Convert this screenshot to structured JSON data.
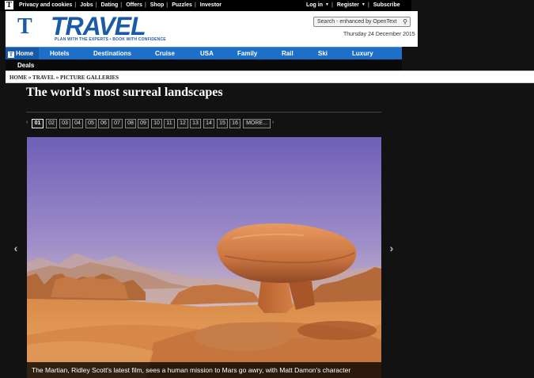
{
  "topbar": {
    "links": [
      "Privacy and cookies",
      "Jobs",
      "Dating",
      "Offers",
      "Shop",
      "Puzzles",
      "Investor"
    ],
    "login": "Log in",
    "register": "Register",
    "subscribe": "Subscribe"
  },
  "masthead": {
    "logo_letter": "T",
    "logo_word": "TRAVEL",
    "tagline": "PLAN WITH THE EXPERTS • BOOK WITH CONFIDENCE",
    "search_placeholder": "Search - enhanced by OpenText",
    "date": "Thursday 24 December 2015"
  },
  "nav": {
    "home": "Home",
    "items": [
      "Hotels",
      "Destinations",
      "Cruise",
      "USA",
      "Family",
      "Rail",
      "Ski",
      "Luxury"
    ],
    "sub_items": [
      "Deals"
    ]
  },
  "breadcrumb": [
    "HOME",
    "TRAVEL",
    "PICTURE GALLERIES"
  ],
  "breadcrumb_sep": "»",
  "page_title": "The world's most surreal landscapes",
  "pager": {
    "prev": "‹",
    "next": "›",
    "pages": [
      "01",
      "02",
      "03",
      "04",
      "05",
      "06",
      "07",
      "08",
      "09",
      "10",
      "11",
      "12",
      "13",
      "14",
      "15",
      "16"
    ],
    "current": "01",
    "more": "MORE..."
  },
  "gallery": {
    "prev_arrow": "‹",
    "next_arrow": "›",
    "caption": "The Martian, Ridley Scott's latest film, sees a human mission to Mars go awry, with Matt Damon's character"
  },
  "colors": {
    "brand_blue": "#1b5aa6",
    "nav_blue": "#1d6fc8",
    "page_bg": "#121212"
  }
}
